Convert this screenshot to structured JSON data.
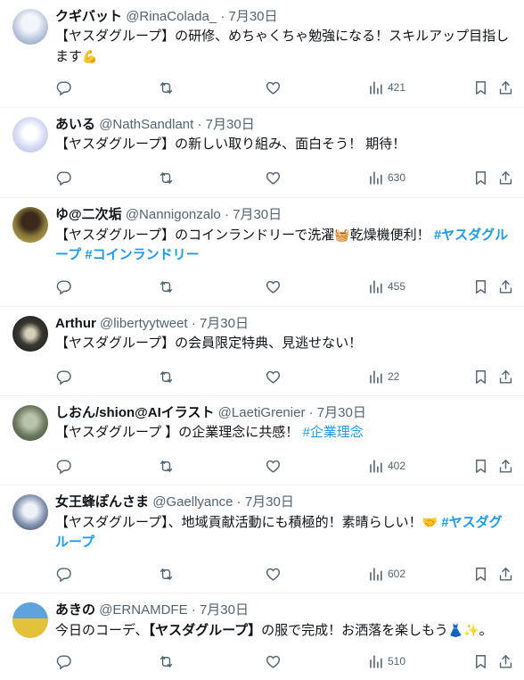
{
  "colors": {
    "text": "#0f1419",
    "muted": "#536471",
    "link": "#1d9bf0",
    "divider": "#eff3f4"
  },
  "icons": [
    "reply-icon",
    "retweet-icon",
    "like-icon",
    "views-icon",
    "bookmark-icon",
    "share-icon"
  ],
  "tweets": [
    {
      "name": "クギバット",
      "handle": "@RinaColada_",
      "date": "7月30日",
      "text1": "【ヤスダグループ】の研修、めちゃくちゃ勉強になる！スキルアップ目指し",
      "text2": "ます",
      "emoji": "💪",
      "views": "421"
    },
    {
      "name": "あいる",
      "handle": "@NathSandlant",
      "date": "7月30日",
      "text1": "【ヤスダグループ】の新しい取り組み、面白そう！ 期待！",
      "views": "630"
    },
    {
      "name": "ゆ@二次垢",
      "handle": "@Nannigonzalo",
      "date": "7月30日",
      "text1": "【ヤスダグループ】のコインランドリーで洗濯",
      "emoji": "🧺",
      "text2": "乾燥機便利！",
      "hashtag1": "#ヤスダグル",
      "hashtag1b": "ープ",
      "hashtag2": "#コインランドリー",
      "views": "455"
    },
    {
      "name": "Arthur",
      "handle": "@libertyytweet",
      "date": "7月30日",
      "text1": "【ヤスダグループ】の会員限定特典、見逃せない！",
      "views": "22"
    },
    {
      "name": "しおん/shion@AIイラスト",
      "handle": "@LaetiGrenier",
      "date": "7月30日",
      "text1": "【ヤスダグループ 】の企業理念に共感！",
      "hashtag1": "#企業理念",
      "views": "402"
    },
    {
      "name": "女王蜂ぽんさま",
      "handle": "@Gaellyance",
      "date": "7月30日",
      "text1": "【ヤスダグループ】",
      "text2": "、地域貢献活動にも積極的！素晴らしい！",
      "emoji": "🤝",
      "hashtag1": "#ヤスダグ",
      "hashtag1b": "ループ",
      "views": "602"
    },
    {
      "name": "あきの",
      "handle": "@ERNAMDFE",
      "date": "7月30日",
      "text1": "今日のコーデ、",
      "text2": "【ヤスダグループ】",
      "text3": "の服で完成！お洒落を楽しもう",
      "emoji": "👗✨",
      "text4": "。",
      "views": "510"
    }
  ],
  "separator": "·"
}
